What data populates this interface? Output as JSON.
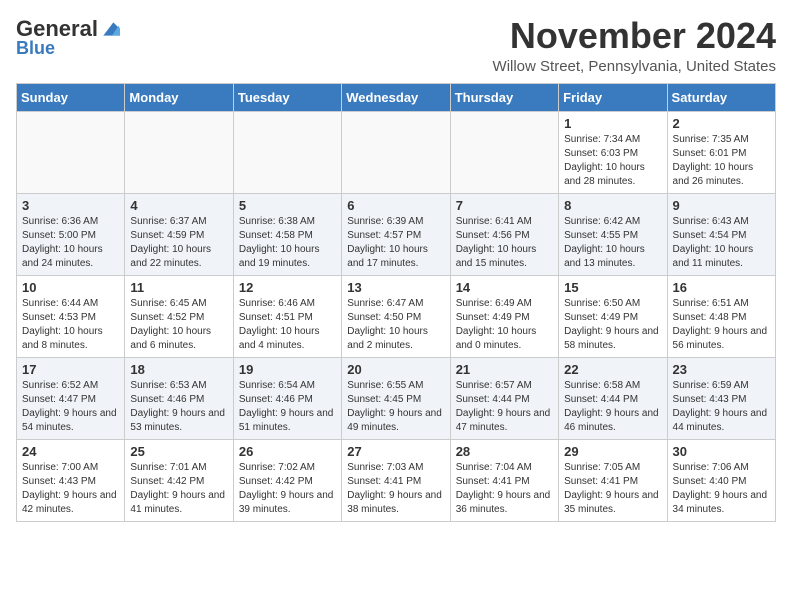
{
  "header": {
    "logo_general": "General",
    "logo_blue": "Blue",
    "month_title": "November 2024",
    "location": "Willow Street, Pennsylvania, United States"
  },
  "days_of_week": [
    "Sunday",
    "Monday",
    "Tuesday",
    "Wednesday",
    "Thursday",
    "Friday",
    "Saturday"
  ],
  "weeks": [
    {
      "days": [
        {
          "num": "",
          "info": ""
        },
        {
          "num": "",
          "info": ""
        },
        {
          "num": "",
          "info": ""
        },
        {
          "num": "",
          "info": ""
        },
        {
          "num": "",
          "info": ""
        },
        {
          "num": "1",
          "info": "Sunrise: 7:34 AM\nSunset: 6:03 PM\nDaylight: 10 hours and 28 minutes."
        },
        {
          "num": "2",
          "info": "Sunrise: 7:35 AM\nSunset: 6:01 PM\nDaylight: 10 hours and 26 minutes."
        }
      ]
    },
    {
      "days": [
        {
          "num": "3",
          "info": "Sunrise: 6:36 AM\nSunset: 5:00 PM\nDaylight: 10 hours and 24 minutes."
        },
        {
          "num": "4",
          "info": "Sunrise: 6:37 AM\nSunset: 4:59 PM\nDaylight: 10 hours and 22 minutes."
        },
        {
          "num": "5",
          "info": "Sunrise: 6:38 AM\nSunset: 4:58 PM\nDaylight: 10 hours and 19 minutes."
        },
        {
          "num": "6",
          "info": "Sunrise: 6:39 AM\nSunset: 4:57 PM\nDaylight: 10 hours and 17 minutes."
        },
        {
          "num": "7",
          "info": "Sunrise: 6:41 AM\nSunset: 4:56 PM\nDaylight: 10 hours and 15 minutes."
        },
        {
          "num": "8",
          "info": "Sunrise: 6:42 AM\nSunset: 4:55 PM\nDaylight: 10 hours and 13 minutes."
        },
        {
          "num": "9",
          "info": "Sunrise: 6:43 AM\nSunset: 4:54 PM\nDaylight: 10 hours and 11 minutes."
        }
      ]
    },
    {
      "days": [
        {
          "num": "10",
          "info": "Sunrise: 6:44 AM\nSunset: 4:53 PM\nDaylight: 10 hours and 8 minutes."
        },
        {
          "num": "11",
          "info": "Sunrise: 6:45 AM\nSunset: 4:52 PM\nDaylight: 10 hours and 6 minutes."
        },
        {
          "num": "12",
          "info": "Sunrise: 6:46 AM\nSunset: 4:51 PM\nDaylight: 10 hours and 4 minutes."
        },
        {
          "num": "13",
          "info": "Sunrise: 6:47 AM\nSunset: 4:50 PM\nDaylight: 10 hours and 2 minutes."
        },
        {
          "num": "14",
          "info": "Sunrise: 6:49 AM\nSunset: 4:49 PM\nDaylight: 10 hours and 0 minutes."
        },
        {
          "num": "15",
          "info": "Sunrise: 6:50 AM\nSunset: 4:49 PM\nDaylight: 9 hours and 58 minutes."
        },
        {
          "num": "16",
          "info": "Sunrise: 6:51 AM\nSunset: 4:48 PM\nDaylight: 9 hours and 56 minutes."
        }
      ]
    },
    {
      "days": [
        {
          "num": "17",
          "info": "Sunrise: 6:52 AM\nSunset: 4:47 PM\nDaylight: 9 hours and 54 minutes."
        },
        {
          "num": "18",
          "info": "Sunrise: 6:53 AM\nSunset: 4:46 PM\nDaylight: 9 hours and 53 minutes."
        },
        {
          "num": "19",
          "info": "Sunrise: 6:54 AM\nSunset: 4:46 PM\nDaylight: 9 hours and 51 minutes."
        },
        {
          "num": "20",
          "info": "Sunrise: 6:55 AM\nSunset: 4:45 PM\nDaylight: 9 hours and 49 minutes."
        },
        {
          "num": "21",
          "info": "Sunrise: 6:57 AM\nSunset: 4:44 PM\nDaylight: 9 hours and 47 minutes."
        },
        {
          "num": "22",
          "info": "Sunrise: 6:58 AM\nSunset: 4:44 PM\nDaylight: 9 hours and 46 minutes."
        },
        {
          "num": "23",
          "info": "Sunrise: 6:59 AM\nSunset: 4:43 PM\nDaylight: 9 hours and 44 minutes."
        }
      ]
    },
    {
      "days": [
        {
          "num": "24",
          "info": "Sunrise: 7:00 AM\nSunset: 4:43 PM\nDaylight: 9 hours and 42 minutes."
        },
        {
          "num": "25",
          "info": "Sunrise: 7:01 AM\nSunset: 4:42 PM\nDaylight: 9 hours and 41 minutes."
        },
        {
          "num": "26",
          "info": "Sunrise: 7:02 AM\nSunset: 4:42 PM\nDaylight: 9 hours and 39 minutes."
        },
        {
          "num": "27",
          "info": "Sunrise: 7:03 AM\nSunset: 4:41 PM\nDaylight: 9 hours and 38 minutes."
        },
        {
          "num": "28",
          "info": "Sunrise: 7:04 AM\nSunset: 4:41 PM\nDaylight: 9 hours and 36 minutes."
        },
        {
          "num": "29",
          "info": "Sunrise: 7:05 AM\nSunset: 4:41 PM\nDaylight: 9 hours and 35 minutes."
        },
        {
          "num": "30",
          "info": "Sunrise: 7:06 AM\nSunset: 4:40 PM\nDaylight: 9 hours and 34 minutes."
        }
      ]
    }
  ]
}
